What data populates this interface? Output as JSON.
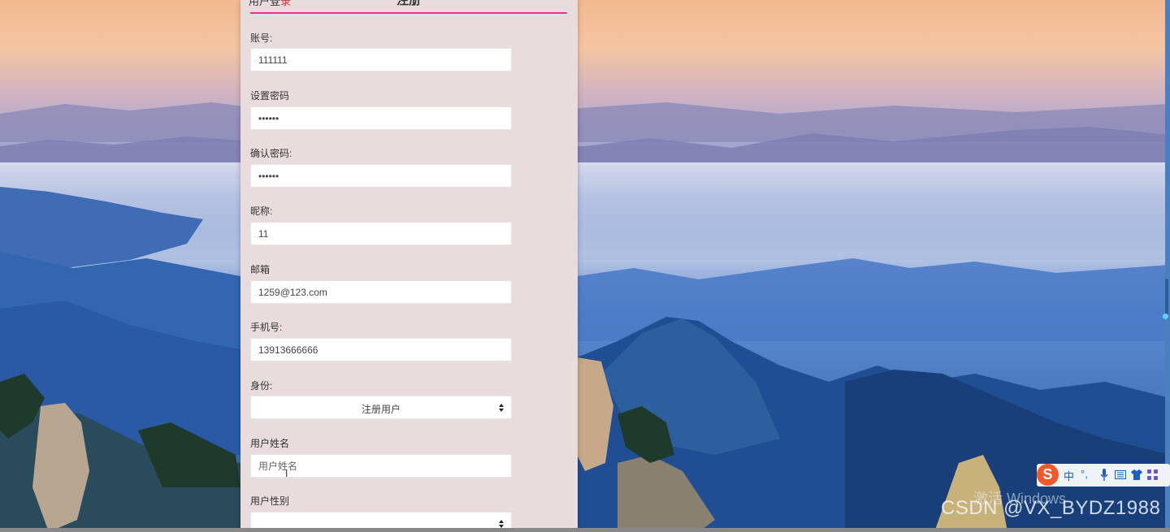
{
  "tabs": {
    "login_label": "用户登",
    "login_highlight": "录",
    "register_label": "注册"
  },
  "form": {
    "account": {
      "label": "账号:",
      "value": "111111"
    },
    "password": {
      "label": "设置密码",
      "value": "••••••"
    },
    "confirm_password": {
      "label": "确认密码:",
      "value": "••••••"
    },
    "nickname": {
      "label": "昵称:",
      "value": "11"
    },
    "email": {
      "label": "邮箱",
      "value": "1259@123.com"
    },
    "phone": {
      "label": "手机号:",
      "value": "13913666666"
    },
    "identity": {
      "label": "身份:",
      "selected": "注册用户"
    },
    "real_name": {
      "label": "用户姓名",
      "placeholder": "用户姓名"
    },
    "gender": {
      "label": "用户性别",
      "selected": ""
    }
  },
  "ime": {
    "logo": "S",
    "lang": "中",
    "punct": "°,",
    "icons": [
      "microphone-icon",
      "keyboard-icon",
      "skin-icon",
      "toolbox-icon"
    ]
  },
  "watermarks": {
    "windows": "激活 Windows",
    "csdn": "CSDN @VX_BYDZ1988"
  },
  "colors": {
    "panel_bg": "#e8dcdc",
    "accent": "#e8319a",
    "ime_brand": "#f0572a"
  }
}
